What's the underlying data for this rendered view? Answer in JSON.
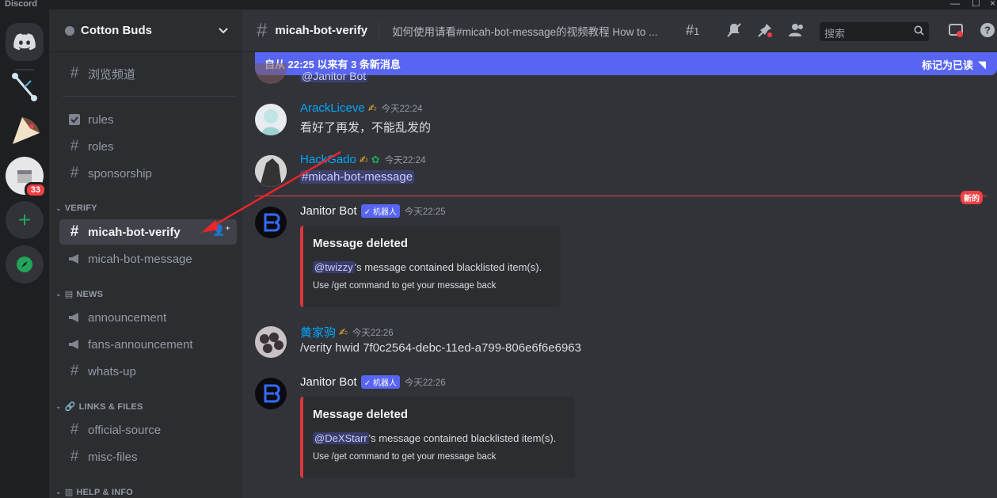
{
  "app": {
    "title": "Discord"
  },
  "colors": {
    "accent": "#5865f2",
    "danger": "#f23f43",
    "link_name": "#00a8fc"
  },
  "rail": {
    "unread_badge": "33"
  },
  "guild": {
    "name": "Cotton Buds"
  },
  "sidebar": {
    "browse": "浏览频道",
    "channels_top": [
      {
        "name": "rules",
        "icon": "rules-icon"
      },
      {
        "name": "roles",
        "icon": "hash-icon"
      },
      {
        "name": "sponsorship",
        "icon": "hash-icon"
      }
    ],
    "categories": {
      "verify": "VERIFY",
      "news": "NEWS",
      "links": "LINKS & FILES",
      "help": "HELP & INFO"
    },
    "verify_channels": [
      "micah-bot-verify",
      "micah-bot-message"
    ],
    "news_channels": [
      "announcement",
      "fans-announcement",
      "whats-up"
    ],
    "links_channels": [
      "official-source",
      "misc-files"
    ]
  },
  "header": {
    "channel": "micah-bot-verify",
    "topic": "如何使用请看#micah-bot-message的视频教程 How to ...",
    "threads_count": "1",
    "search_placeholder": "搜索"
  },
  "newbar": {
    "text": "自从 22:25 以来有 3 条新消息",
    "mark_read": "标记为已读"
  },
  "partial_mention": "@Janitor Bot",
  "messages": [
    {
      "user": "ArackLiceve",
      "time": "今天22:24",
      "text": "看好了再发，不能乱发的"
    },
    {
      "user": "HackGado",
      "time": "今天22:24",
      "text": "#micah-bot-message"
    },
    {
      "user": "Janitor Bot",
      "bot_tag": "✓ 机器人",
      "time": "今天22:25",
      "embed": {
        "title": "Message deleted",
        "mention": "@twizzy",
        "desc": "'s message contained blacklisted item(s).",
        "footer": "Use /get command to get your message back"
      }
    },
    {
      "user": "黄家驹",
      "time": "今天22:26",
      "text": "/verity hwid 7f0c2564-debc-11ed-a799-806e6f6e6963"
    },
    {
      "user": "Janitor Bot",
      "bot_tag": "✓ 机器人",
      "time": "今天22:26",
      "embed": {
        "title": "Message deleted",
        "mention": "@DeXStarr",
        "desc": "'s message contained blacklisted item(s).",
        "footer": "Use /get command to get your message back"
      }
    }
  ],
  "new_divider": "新的"
}
